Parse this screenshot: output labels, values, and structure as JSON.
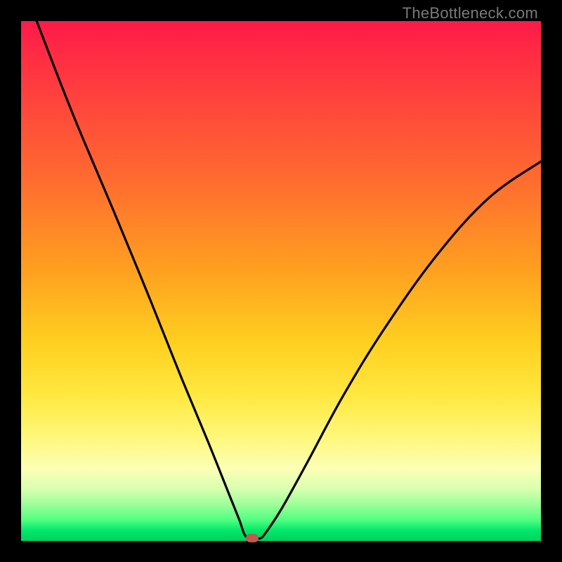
{
  "watermark": "TheBottleneck.com",
  "colors": {
    "frame": "#000000",
    "gradient_top": "#ff1a49",
    "gradient_bottom": "#00d05e",
    "curve": "#000000",
    "marker": "#c4574f",
    "watermark_text": "#7a7a7a"
  },
  "chart_data": {
    "type": "line",
    "title": "",
    "xlabel": "",
    "ylabel": "",
    "xlim": [
      0,
      100
    ],
    "ylim": [
      0,
      100
    ],
    "grid": false,
    "series": [
      {
        "name": "bottleneck-curve",
        "x": [
          3,
          10,
          18,
          25,
          31,
          36,
          40,
          42,
          43,
          44,
          45,
          46,
          47,
          50,
          55,
          62,
          70,
          80,
          90,
          100
        ],
        "values": [
          100,
          82,
          63,
          46,
          31,
          19,
          9,
          4,
          1.2,
          0.5,
          0.5,
          0.5,
          1.5,
          6,
          15,
          28,
          41,
          55,
          66,
          73
        ]
      }
    ],
    "annotations": [
      {
        "name": "minimum-marker",
        "x": 44.5,
        "y": 0.5
      }
    ],
    "legend": false
  }
}
